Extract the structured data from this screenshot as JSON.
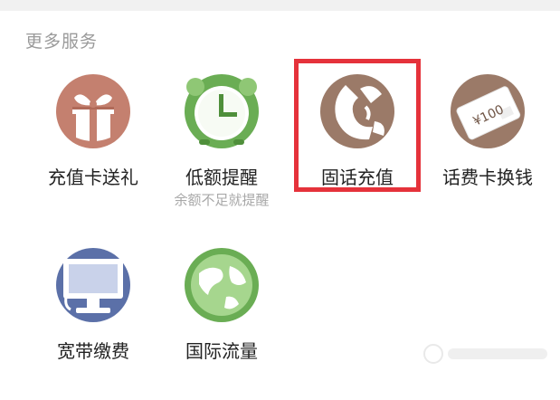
{
  "section": {
    "title": "更多服务"
  },
  "services": [
    {
      "label": "充值卡送礼",
      "icon": "gift-icon",
      "color": "#c4806f"
    },
    {
      "label": "低额提醒",
      "sub": "余额不足就提醒",
      "icon": "alarm-clock-icon",
      "color": "#6aad54"
    },
    {
      "label": "固话充值",
      "icon": "telephone-handset-icon",
      "color": "#9b7a68"
    },
    {
      "label": "话费卡换钱",
      "icon": "recharge-card-icon",
      "color": "#9b7a68",
      "card_text": "¥100"
    },
    {
      "label": "宽带缴费",
      "icon": "computer-monitor-icon",
      "color": "#5b70a8"
    },
    {
      "label": "国际流量",
      "icon": "globe-icon",
      "color": "#6aad54"
    }
  ],
  "selection": {
    "color": "#e5323b"
  }
}
